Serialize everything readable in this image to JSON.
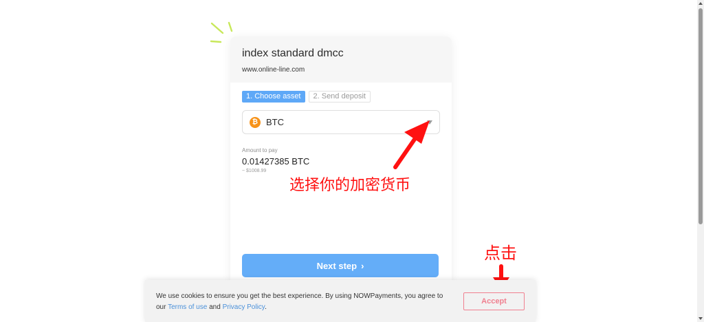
{
  "merchant": {
    "name": "index standard dmcc",
    "url": "www.online-line.com"
  },
  "steps": [
    {
      "label": "1. Choose asset",
      "active": true
    },
    {
      "label": "2. Send deposit",
      "active": false
    }
  ],
  "asset_select": {
    "icon": "bitcoin-icon",
    "icon_glyph": "₿",
    "icon_color": "#f7931a",
    "selected": "BTC"
  },
  "amount": {
    "label": "Amount to pay",
    "value": "0.01427385 BTC",
    "usd": "~ $1008.99"
  },
  "next_button": {
    "label": "Next step",
    "chevron": "›",
    "color": "#64adf8"
  },
  "annotations": {
    "select_currency": "选择你的加密货币",
    "click": "点击",
    "color": "#ff1111"
  },
  "cookie_banner": {
    "text_before": "We use cookies to ensure you get the best experience. By using NOWPayments, you agree to our ",
    "terms_link": "Terms of use",
    "and": " and ",
    "privacy_link": "Privacy Policy",
    "text_after": ".",
    "accept_label": "Accept",
    "accept_color": "#f07f8f"
  }
}
